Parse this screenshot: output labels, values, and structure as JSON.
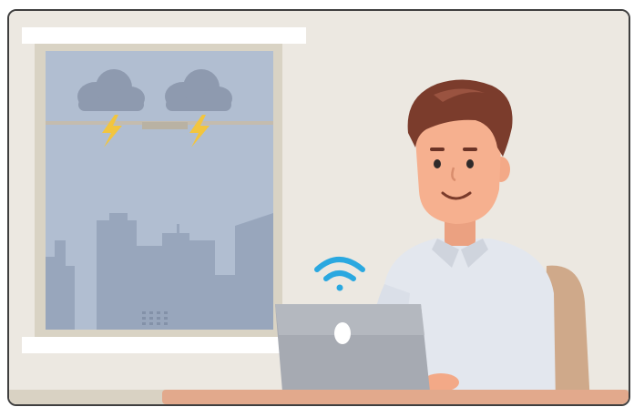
{
  "scene": {
    "colors": {
      "wall": "#ece8e1",
      "sky": "#b0bdd0",
      "window_frame": "#dcd6c8",
      "cloud": "#8f9bb0",
      "lightning": "#f2c53d",
      "buildings": "#97a5bb",
      "skin": "#f6b08f",
      "hair": "#7a3b2b",
      "shirt": "#e3e7ee",
      "laptop": "#a9adb5",
      "wifi": "#2aa8e0",
      "desk": "#e2a98c",
      "chair": "#cfa889"
    },
    "icons": [
      "storm-cloud-icon",
      "lightning-icon",
      "wifi-icon",
      "laptop-logo-icon"
    ]
  }
}
